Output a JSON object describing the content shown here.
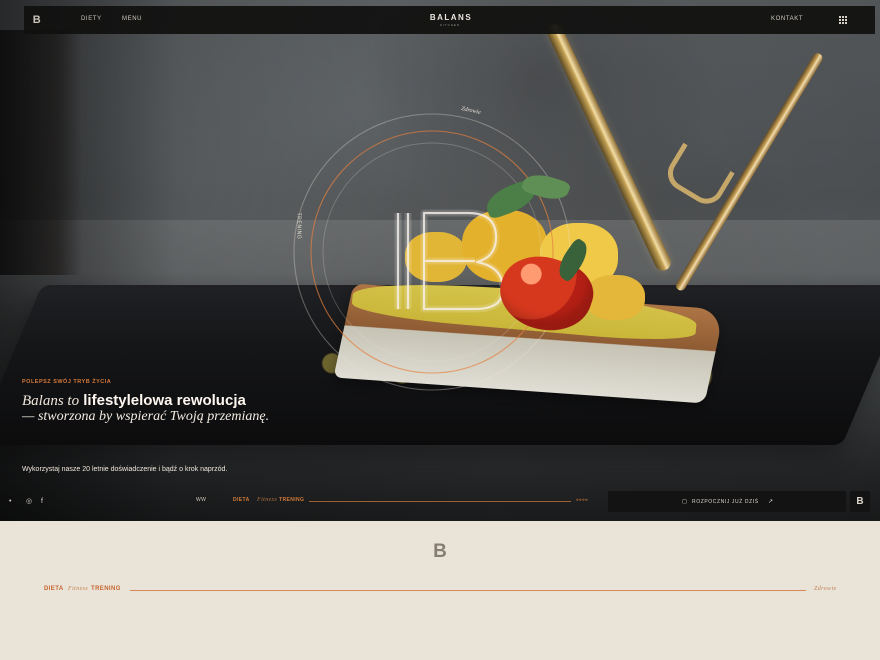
{
  "navbar": {
    "items": [
      {
        "label": "DIETY"
      },
      {
        "label": "MENU"
      },
      {
        "label": "KONTAKT"
      }
    ],
    "brand": "BALANS",
    "brand_sub": "kitchen",
    "logo_glyph": "B",
    "menu_icon": "grid-dots-icon"
  },
  "hero": {
    "ring_label_top": "Zdrowie",
    "ring_label_side": "TRENING",
    "eyebrow": "POLEPSZ SWÓJ TRYB ŻYCIA",
    "title_prefix": "Balans to",
    "title_highlight": "lifestylelowa rewolucja",
    "title_suffix": "— stworzona by wspierać Twoją przemianę.",
    "description": "Wykorzystaj nasze 20 letnie doświadczenie i bądź o krok naprzód.",
    "social": {
      "first": "•",
      "instagram": "◎",
      "facebook": "f"
    },
    "tabs": {
      "first": "WW",
      "diet": "DIETA",
      "fitness": "Fitness",
      "training": "TRENING",
      "end": "⟡⟡⟡⟡"
    },
    "cta": {
      "icon": "shopping-bag-icon",
      "label": "ROZPOCZNIJ JUŻ DZIŚ",
      "arrow": "↗"
    },
    "logo_glyph": "B"
  },
  "lower": {
    "logo_glyph": "B",
    "tabs": {
      "diet": "DIETA",
      "fitness": "Fitness",
      "training": "TRENING",
      "health": "Zdrowie"
    }
  },
  "colors": {
    "accent": "#d67a39",
    "nav_bg": "#10100f",
    "light_bg": "#e9e3d8"
  }
}
